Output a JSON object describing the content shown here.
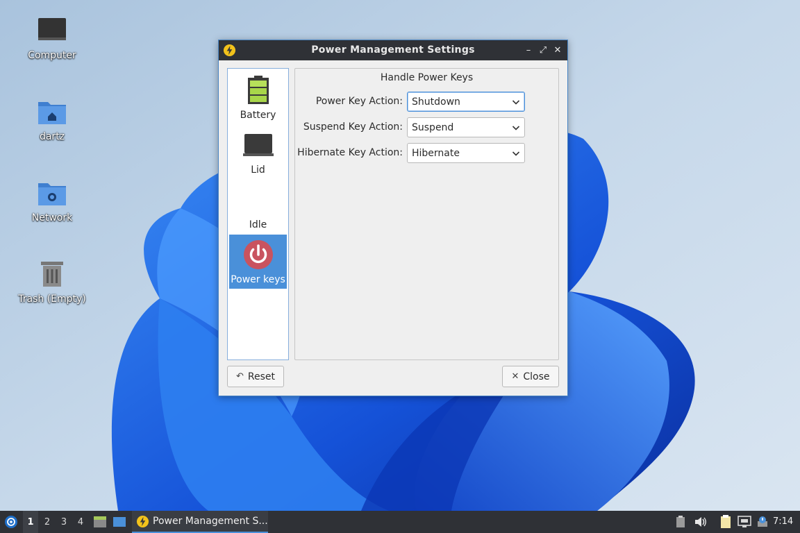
{
  "desktop": {
    "icons": [
      {
        "label": "Computer",
        "icon": "computer-icon"
      },
      {
        "label": "dartz",
        "icon": "home-folder-icon"
      },
      {
        "label": "Network",
        "icon": "network-folder-icon"
      },
      {
        "label": "Trash (Empty)",
        "icon": "trash-icon"
      }
    ]
  },
  "window": {
    "title": "Power Management Settings",
    "app_icon": "lightning-icon",
    "controls": {
      "minimize": "–",
      "maximize": "⤢",
      "close": "✕"
    },
    "sidebar": {
      "items": [
        {
          "label": "Battery",
          "icon": "battery-icon",
          "selected": false
        },
        {
          "label": "Lid",
          "icon": "laptop-lid-icon",
          "selected": false
        },
        {
          "label": "Idle",
          "icon": "idle-icon",
          "selected": false
        },
        {
          "label": "Power keys",
          "icon": "power-icon",
          "selected": true
        }
      ]
    },
    "panel": {
      "title": "Handle Power Keys",
      "rows": [
        {
          "label": "Power Key Action:",
          "value": "Shutdown"
        },
        {
          "label": "Suspend Key Action:",
          "value": "Suspend"
        },
        {
          "label": "Hibernate Key Action:",
          "value": "Hibernate"
        }
      ]
    },
    "buttons": {
      "reset": {
        "label": "Reset",
        "icon": "undo-icon"
      },
      "close": {
        "label": "Close",
        "icon": "close-icon"
      }
    }
  },
  "taskbar": {
    "workspaces": [
      "1",
      "2",
      "3",
      "4"
    ],
    "active_workspace": "1",
    "task": {
      "label": "Power Management S..."
    },
    "clock": "7:14"
  },
  "colors": {
    "accent": "#4a90d9",
    "titlebar": "#2f3136",
    "taskbar": "#2f3136",
    "power_icon": "#c9535f",
    "battery_icon": "#a8d64a"
  }
}
